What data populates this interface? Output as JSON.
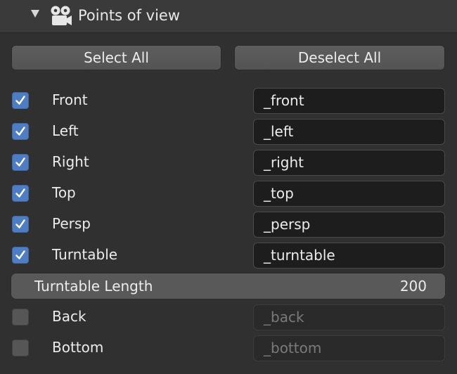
{
  "panel": {
    "title": "Points of view",
    "icon": "camera-icon"
  },
  "buttons": {
    "select_all": "Select All",
    "deselect_all": "Deselect All"
  },
  "views": [
    {
      "label": "Front",
      "checked": true,
      "suffix": "_front"
    },
    {
      "label": "Left",
      "checked": true,
      "suffix": "_left"
    },
    {
      "label": "Right",
      "checked": true,
      "suffix": "_right"
    },
    {
      "label": "Top",
      "checked": true,
      "suffix": "_top"
    },
    {
      "label": "Persp",
      "checked": true,
      "suffix": "_persp"
    },
    {
      "label": "Turntable",
      "checked": true,
      "suffix": "_turntable"
    },
    {
      "label": "Back",
      "checked": false,
      "suffix": "_back"
    },
    {
      "label": "Bottom",
      "checked": false,
      "suffix": "_bottom"
    }
  ],
  "turntable_length": {
    "label": "Turntable Length",
    "value": "200"
  },
  "colors": {
    "checkbox_on": "#4f7dc4",
    "background": "#303030",
    "header": "#3a3a3a"
  }
}
